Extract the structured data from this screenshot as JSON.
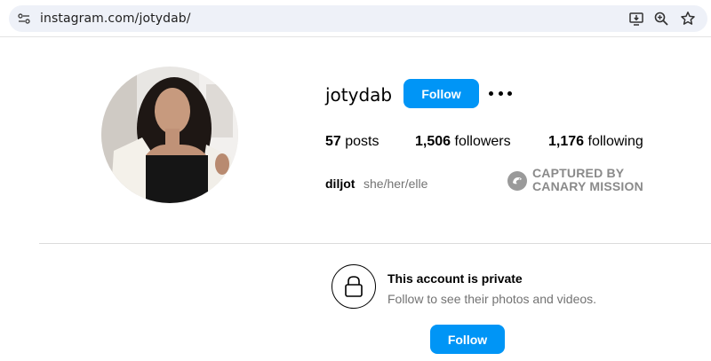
{
  "browser": {
    "url": "instagram.com/jotydab/",
    "icons": [
      "site-settings-icon",
      "install-app-icon",
      "zoom-icon",
      "bookmark-star-icon"
    ]
  },
  "profile": {
    "username": "jotydab",
    "follow_label": "Follow",
    "posts_count": "57",
    "posts_label": "posts",
    "followers_count": "1,506",
    "followers_label": "followers",
    "following_count": "1,176",
    "following_label": "following",
    "full_name": "diljot",
    "pronouns": "she/her/elle"
  },
  "watermark": {
    "line1": "CAPTURED BY",
    "line2": "CANARY MISSION"
  },
  "private": {
    "title": "This account is private",
    "subtitle": "Follow to see their photos and videos.",
    "follow_label": "Follow"
  },
  "colors": {
    "accent": "#0095f6",
    "muted_text": "#737373",
    "divider": "#dbdbdb",
    "omnibox_bg": "#eef1f8"
  }
}
